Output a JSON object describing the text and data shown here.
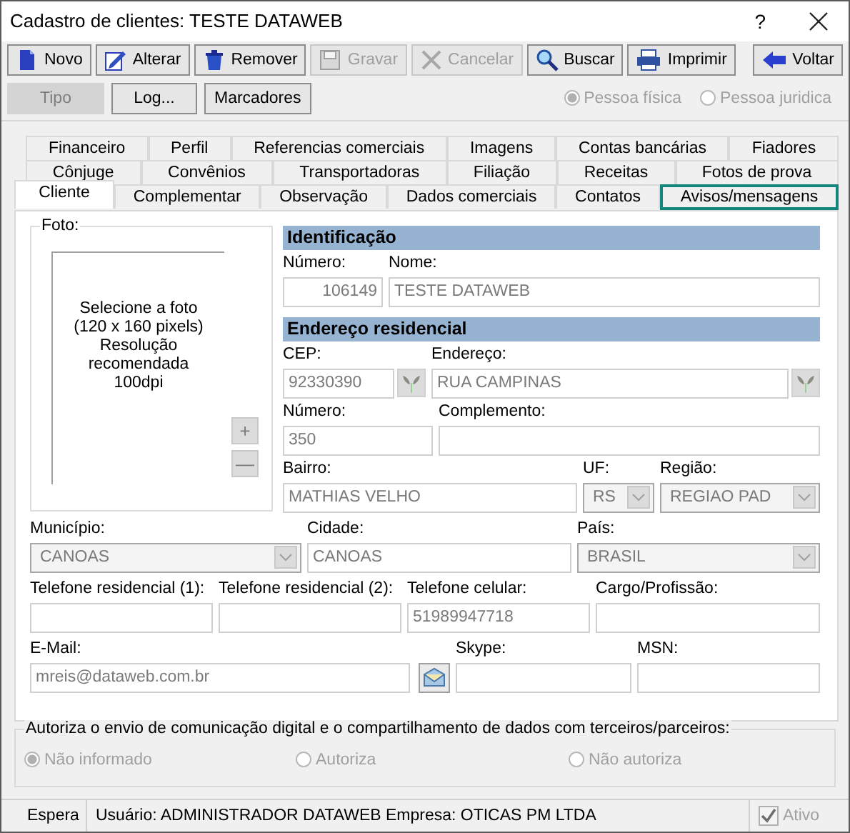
{
  "window": {
    "title": "Cadastro de clientes: TESTE DATAWEB",
    "help": "?"
  },
  "toolbar": [
    {
      "label": "Novo",
      "disabled": false
    },
    {
      "label": "Alterar",
      "disabled": false
    },
    {
      "label": "Remover",
      "disabled": false
    },
    {
      "label": "Gravar",
      "disabled": true
    },
    {
      "label": "Cancelar",
      "disabled": true
    },
    {
      "label": "Buscar",
      "disabled": false
    },
    {
      "label": "Imprimir",
      "disabled": false
    },
    {
      "label": "Voltar",
      "disabled": false
    }
  ],
  "secondary_buttons": [
    {
      "label": "Tipo",
      "disabled": true
    },
    {
      "label": "Log...",
      "disabled": false
    },
    {
      "label": "Marcadores",
      "disabled": false
    }
  ],
  "person_type": [
    {
      "label": "Pessoa física",
      "selected": true,
      "disabled": true
    },
    {
      "label": "Pessoa juridica",
      "selected": false,
      "disabled": true
    }
  ],
  "tab_rows": [
    [
      {
        "label": "Financeiro",
        "selected": false,
        "focused": false
      },
      {
        "label": "Perfil",
        "selected": false,
        "focused": false
      },
      {
        "label": "Referencias comerciais",
        "selected": false,
        "focused": false
      },
      {
        "label": "Imagens",
        "selected": false,
        "focused": false
      },
      {
        "label": "Contas bancárias",
        "selected": false,
        "focused": false
      },
      {
        "label": "Fiadores",
        "selected": false,
        "focused": false
      }
    ],
    [
      {
        "label": "Cônjuge",
        "selected": false,
        "focused": false
      },
      {
        "label": "Convênios",
        "selected": false,
        "focused": false
      },
      {
        "label": "Transportadoras",
        "selected": false,
        "focused": false
      },
      {
        "label": "Filiação",
        "selected": false,
        "focused": false
      },
      {
        "label": "Receitas",
        "selected": false,
        "focused": false
      },
      {
        "label": "Fotos de prova",
        "selected": false,
        "focused": false
      }
    ],
    [
      {
        "label": "Cliente",
        "selected": true,
        "focused": false
      },
      {
        "label": "Complementar",
        "selected": false,
        "focused": false
      },
      {
        "label": "Observação",
        "selected": false,
        "focused": false
      },
      {
        "label": "Dados comerciais",
        "selected": false,
        "focused": false
      },
      {
        "label": "Contatos",
        "selected": false,
        "focused": false
      },
      {
        "label": "Avisos/mensagens",
        "selected": false,
        "focused": true
      }
    ]
  ],
  "photo": {
    "label": "Foto:",
    "hint": [
      "Selecione a foto",
      "(120 x 160 pixels)",
      "Resolução",
      "recomendada",
      "100dpi"
    ],
    "buttons": [
      {
        "label": "+"
      },
      {
        "label": "—"
      }
    ]
  },
  "identificacao": {
    "heading": "Identificação",
    "fields": [
      {
        "label": "Número:",
        "value": "106149",
        "kind": "number",
        "disabled": true
      },
      {
        "label": "Nome:",
        "value": "TESTE DATAWEB",
        "kind": "text",
        "disabled": true
      }
    ]
  },
  "endereco": {
    "heading": "Endereço residencial",
    "rows": [
      [
        {
          "label": "CEP:",
          "value": "92330390",
          "kind": "lookup",
          "disabled": true
        },
        {
          "label": "Endereço:",
          "value": "RUA CAMPINAS",
          "kind": "lookup",
          "disabled": true
        }
      ],
      [
        {
          "label": "Número:",
          "value": "350",
          "kind": "text",
          "disabled": true
        },
        {
          "label": "Complemento:",
          "kind": "text"
        }
      ],
      [
        {
          "label": "Bairro:",
          "value": "MATHIAS VELHO",
          "kind": "text",
          "disabled": true
        },
        {
          "label": "UF:",
          "value": "RS",
          "kind": "select",
          "disabled": true
        },
        {
          "label": "Região:",
          "value": "REGIAO PAD",
          "kind": "select",
          "disabled": true
        }
      ]
    ]
  },
  "contact_rows": [
    [
      {
        "label": "Município:",
        "value": "CANOAS",
        "kind": "select",
        "disabled": true
      },
      {
        "label": "Cidade:",
        "value": "CANOAS",
        "kind": "text",
        "disabled": true
      },
      {
        "label": "País:",
        "value": "BRASIL",
        "kind": "select",
        "disabled": true
      }
    ],
    [
      {
        "label": "Telefone residencial (1):",
        "kind": "text"
      },
      {
        "label": "Telefone residencial (2):",
        "kind": "text"
      },
      {
        "label": "Telefone celular:",
        "value": "51989947718",
        "kind": "text",
        "disabled": true
      },
      {
        "label": "Cargo/Profissão:",
        "kind": "text"
      }
    ],
    [
      {
        "label": "E-Mail:",
        "value": "mreis@dataweb.com.br",
        "kind": "mail",
        "disabled": true
      },
      {
        "label": "Skype:",
        "kind": "text"
      },
      {
        "label": "MSN:",
        "kind": "text"
      }
    ]
  ],
  "consent": {
    "legend": "Autoriza o envio de comunicação digital e o compartilhamento de dados com terceiros/parceiros:",
    "options": [
      {
        "label": "Não informado",
        "selected": true,
        "disabled": true
      },
      {
        "label": "Autoriza",
        "selected": false,
        "disabled": true
      },
      {
        "label": "Não autoriza",
        "selected": false,
        "disabled": true
      }
    ]
  },
  "status_bar": {
    "state": "Espera",
    "info": "Usuário: ADMINISTRADOR DATAWEB Empresa: OTICAS PM LTDA",
    "active": {
      "label": "Ativo",
      "checked": true,
      "disabled": true
    }
  }
}
